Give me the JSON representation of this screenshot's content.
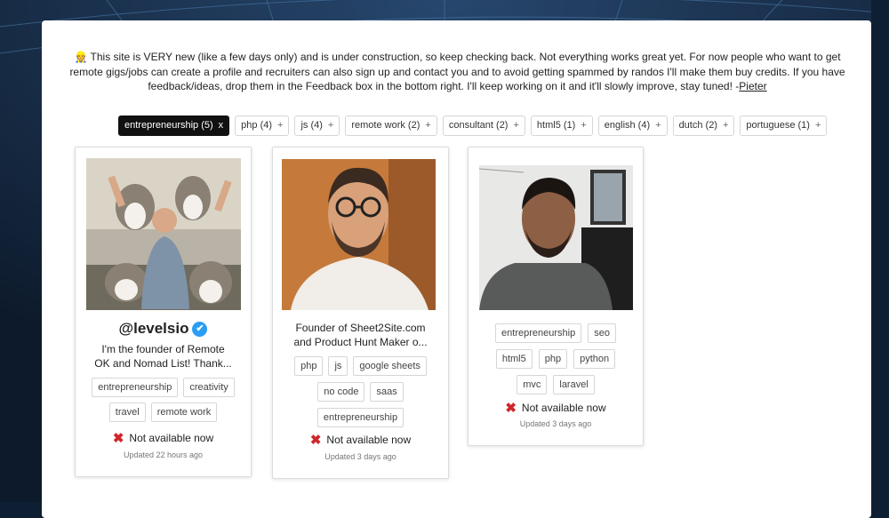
{
  "notice": {
    "icon": "construction-worker-icon",
    "text": "This site is VERY new (like a few days only) and is under construction, so keep checking back. Not everything works great yet. For now people who want to get remote gigs/jobs can create a profile and recruiters can also sign up and contact you and to avoid getting spammed by randos I'll make them buy credits. If you have feedback/ideas, drop them in the Feedback box in the bottom right. I'll keep working on it and it'll slowly improve, stay tuned! -",
    "author_link": "Pieter"
  },
  "filters": [
    {
      "label": "entrepreneurship (5)",
      "op": "x",
      "active": true
    },
    {
      "label": "php (4)",
      "op": "+"
    },
    {
      "label": "js (4)",
      "op": "+"
    },
    {
      "label": "remote work (2)",
      "op": "+"
    },
    {
      "label": "consultant (2)",
      "op": "+"
    },
    {
      "label": "html5 (1)",
      "op": "+"
    },
    {
      "label": "english (4)",
      "op": "+"
    },
    {
      "label": "dutch (2)",
      "op": "+"
    },
    {
      "label": "portuguese (1)",
      "op": "+"
    }
  ],
  "profiles": [
    {
      "name": "@levelsio",
      "verified": true,
      "bio": "I'm the founder of Remote OK and Nomad List! Thank...",
      "tags": [
        "entrepreneurship",
        "creativity",
        "travel",
        "remote work"
      ],
      "availability": "Not available now",
      "updated": "Updated 22 hours ago"
    },
    {
      "bio": "Founder of Sheet2Site.com and Product Hunt Maker o...",
      "tags": [
        "php",
        "js",
        "google sheets",
        "no code",
        "saas",
        "entrepreneurship"
      ],
      "availability": "Not available now",
      "updated": "Updated 3 days ago"
    },
    {
      "tags": [
        "entrepreneurship",
        "seo",
        "html5",
        "php",
        "python",
        "mvc",
        "laravel"
      ],
      "availability": "Not available now",
      "updated": "Updated 3 days ago"
    }
  ]
}
